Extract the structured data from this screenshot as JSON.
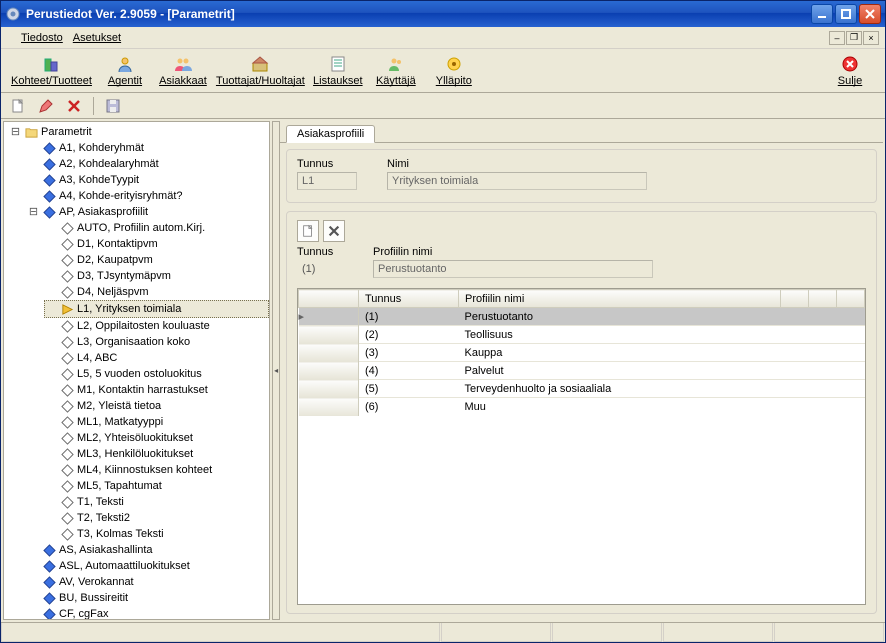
{
  "window": {
    "title": "Perustiedot Ver. 2.9059 - [Parametrit]"
  },
  "menu": {
    "tiedosto": "Tiedosto",
    "asetukset": "Asetukset"
  },
  "toolbar": {
    "kohteet": "Kohteet/Tuotteet",
    "agentit": "Agentit",
    "asiakkaat": "Asiakkaat",
    "tuottajat": "Tuottajat/Huoltajat",
    "listaukset": "Listaukset",
    "kayttaja": "Käyttäjä",
    "yllapito": "Ylläpito",
    "sulje": "Sulje"
  },
  "tree": {
    "root": "Parametrit",
    "items_lvl1": [
      "A1, Kohderyhmät",
      "A2, Kohdealaryhmät",
      "A3, KohdeTyypit",
      "A4, Kohde-erityisryhmät?"
    ],
    "ap": "AP, Asiakasprofiilit",
    "ap_children": [
      "AUTO, Profiilin autom.Kirj.",
      "D1, Kontaktipvm",
      "D2, Kaupatpvm",
      "D3, TJsyntymäpvm",
      "D4, Neljäspvm",
      "L1, Yrityksen toimiala",
      "L2, Oppilaitosten kouluaste",
      "L3, Organisaation koko",
      "L4, ABC",
      "L5, 5 vuoden ostoluokitus",
      "M1, Kontaktin harrastukset",
      "M2, Yleistä tietoa",
      "ML1, Matkatyyppi",
      "ML2, Yhteisöluokitukset",
      "ML3, Henkilöluokitukset",
      "ML4, Kiinnostuksen kohteet",
      "ML5, Tapahtumat",
      "T1, Teksti",
      "T2, Teksti2",
      "T3, Kolmas Teksti"
    ],
    "items_after": [
      "AS, Asiakashallinta",
      "ASL, Automaattiluokitukset",
      "AV, Verokannat",
      "BU, Bussireitit",
      "CF, cgFax"
    ]
  },
  "detail": {
    "tab": "Asiakasprofiili",
    "tunnus_label": "Tunnus",
    "nimi_label": "Nimi",
    "tunnus_value": "L1",
    "nimi_value": "Yrityksen toimiala",
    "profiilin_nimi_label": "Profiilin nimi",
    "current_row_id": "(1)",
    "current_row_name": "Perustuotanto",
    "grid": {
      "col_tunnus": "Tunnus",
      "col_nimi": "Profiilin nimi",
      "rows": [
        {
          "id": "(1)",
          "name": "Perustuotanto"
        },
        {
          "id": "(2)",
          "name": "Teollisuus"
        },
        {
          "id": "(3)",
          "name": "Kauppa"
        },
        {
          "id": "(4)",
          "name": "Palvelut"
        },
        {
          "id": "(5)",
          "name": "Terveydenhuolto ja sosiaaliala"
        },
        {
          "id": "(6)",
          "name": "Muu"
        }
      ]
    }
  }
}
